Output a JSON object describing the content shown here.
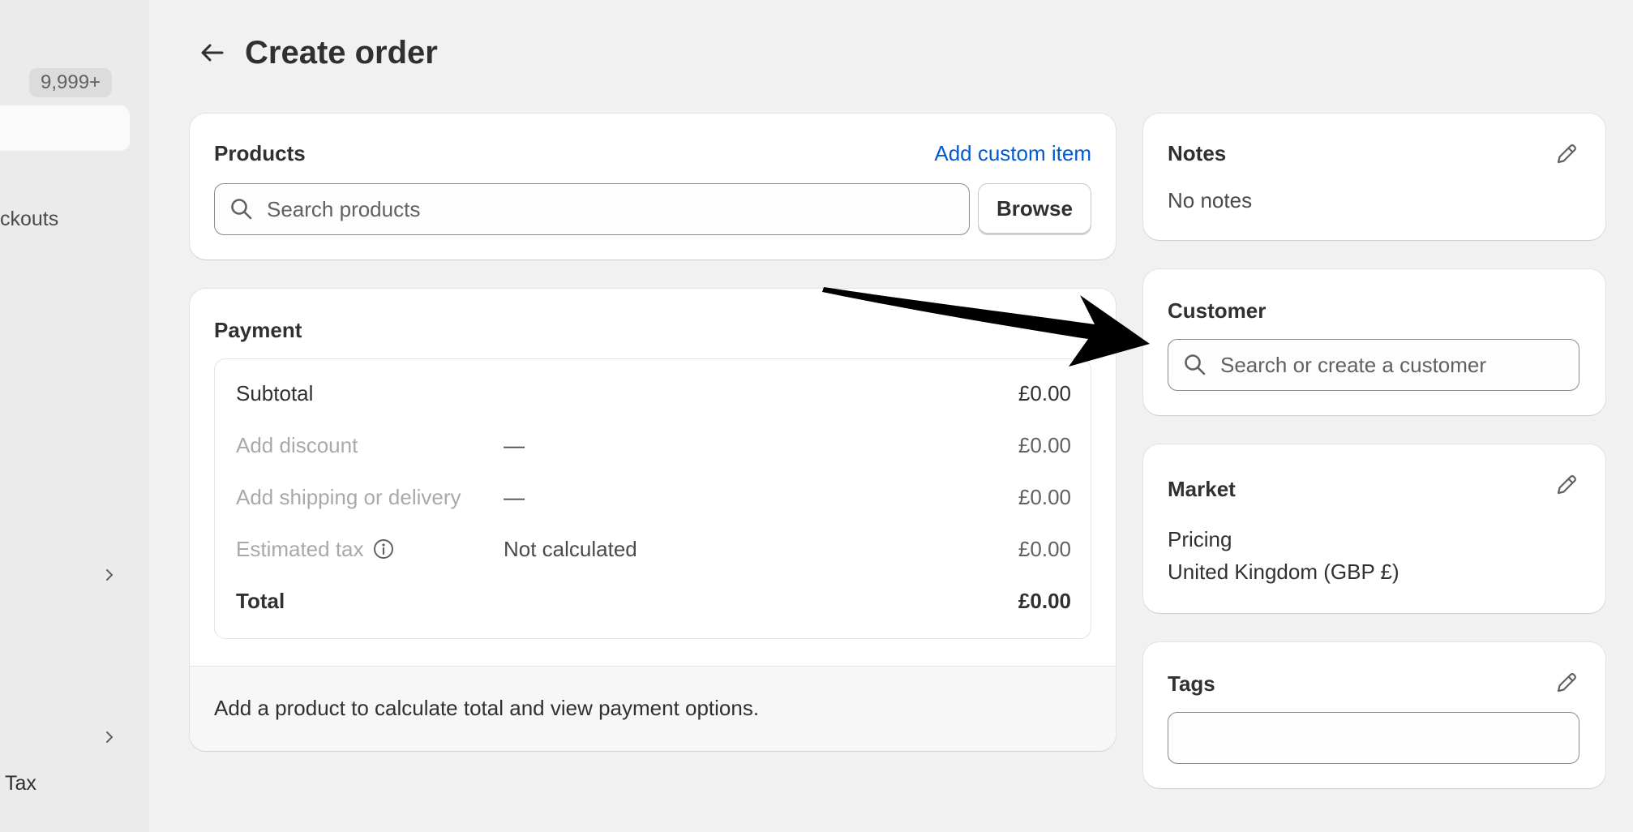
{
  "sidebar": {
    "badge": "9,999+",
    "item_checkouts": "ckouts",
    "item_tax": "Tax"
  },
  "header": {
    "title": "Create order"
  },
  "products": {
    "title": "Products",
    "add_custom_item": "Add custom item",
    "search_placeholder": "Search products",
    "browse_label": "Browse"
  },
  "payment": {
    "title": "Payment",
    "rows": {
      "subtotal": {
        "label": "Subtotal",
        "value": "£0.00"
      },
      "discount": {
        "label": "Add discount",
        "detail": "—",
        "value": "£0.00"
      },
      "shipping": {
        "label": "Add shipping or delivery",
        "detail": "—",
        "value": "£0.00"
      },
      "tax": {
        "label": "Estimated tax",
        "detail": "Not calculated",
        "value": "£0.00"
      },
      "total": {
        "label": "Total",
        "value": "£0.00"
      }
    },
    "footer": "Add a product to calculate total and view payment options."
  },
  "notes": {
    "title": "Notes",
    "body": "No notes"
  },
  "customer": {
    "title": "Customer",
    "search_placeholder": "Search or create a customer"
  },
  "market": {
    "title": "Market",
    "pricing_label": "Pricing",
    "pricing_value": "United Kingdom (GBP £)"
  },
  "tags": {
    "title": "Tags",
    "value": ""
  },
  "colors": {
    "accent_link": "#005bd3",
    "page_bg": "#f1f1f1",
    "card_bg": "#ffffff"
  }
}
